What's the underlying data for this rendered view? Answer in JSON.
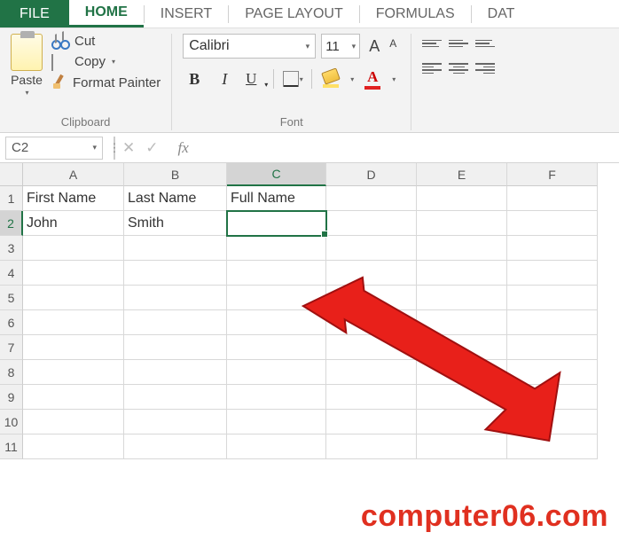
{
  "tabs": {
    "file": "FILE",
    "home": "HOME",
    "insert": "INSERT",
    "pagelayout": "PAGE LAYOUT",
    "formulas": "FORMULAS",
    "data": "DAT"
  },
  "clipboard": {
    "paste": "Paste",
    "cut": "Cut",
    "copy": "Copy",
    "formatpainter": "Format Painter",
    "label": "Clipboard"
  },
  "font": {
    "name": "Calibri",
    "size": "11",
    "label": "Font",
    "bold": "B",
    "italic": "I",
    "underline": "U",
    "biga": "A",
    "smalla": "A"
  },
  "namebox": "C2",
  "columns": [
    "A",
    "B",
    "C",
    "D",
    "E",
    "F"
  ],
  "rows": [
    "1",
    "2",
    "3",
    "4",
    "5",
    "6",
    "7",
    "8",
    "9",
    "10",
    "11"
  ],
  "cells": {
    "A1": "First Name",
    "B1": "Last Name",
    "C1": "Full Name",
    "A2": "John",
    "B2": "Smith"
  },
  "watermark": "computer06.com",
  "fx": "fx"
}
